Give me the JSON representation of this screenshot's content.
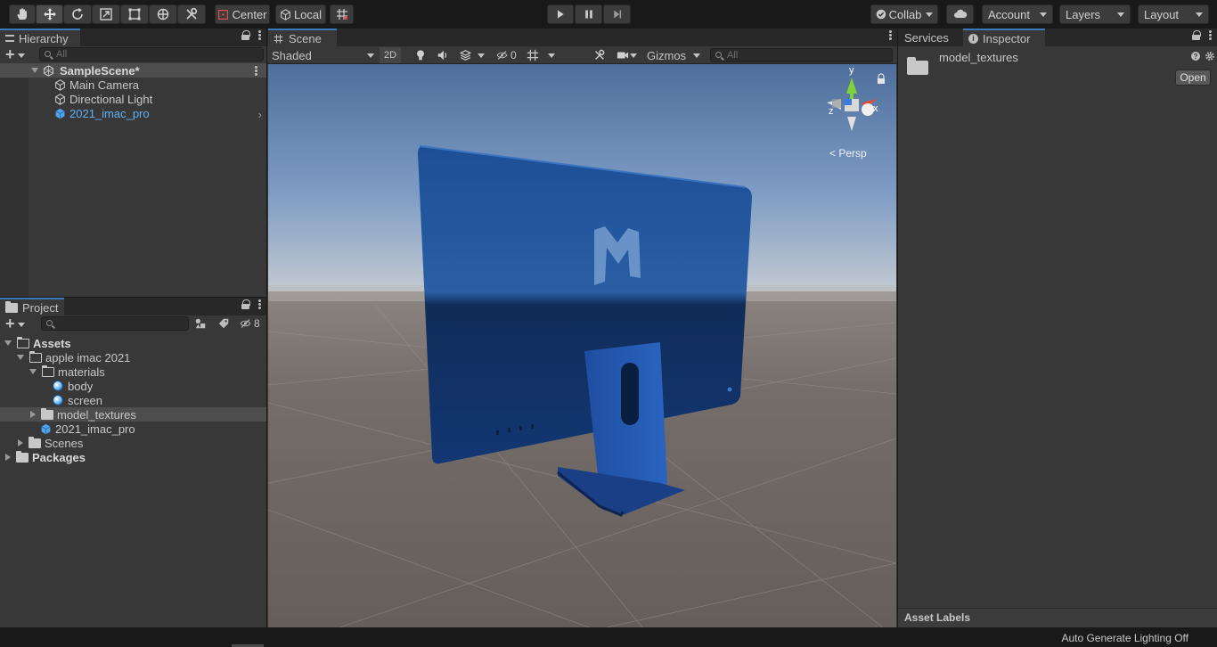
{
  "toolbar": {
    "pivot_mode": "Center",
    "pivot_rotation": "Local",
    "collab_label": "Collab",
    "account_label": "Account",
    "layers_label": "Layers",
    "layout_label": "Layout"
  },
  "hierarchy": {
    "tab_label": "Hierarchy",
    "search_placeholder": "All",
    "scene_name": "SampleScene*",
    "items": [
      {
        "label": "Main Camera",
        "icon": "gameobject-icon"
      },
      {
        "label": "Directional Light",
        "icon": "gameobject-icon"
      },
      {
        "label": "2021_imac_pro",
        "icon": "prefab-icon"
      }
    ]
  },
  "project": {
    "tab_label": "Project",
    "search_placeholder": "",
    "hidden_count": "8",
    "tree": [
      {
        "label": "Assets",
        "icon": "folder-open-icon"
      },
      {
        "label": "apple imac 2021",
        "icon": "folder-open-icon"
      },
      {
        "label": "materials",
        "icon": "folder-open-icon"
      },
      {
        "label": "body",
        "icon": "material-icon"
      },
      {
        "label": "screen",
        "icon": "material-icon"
      },
      {
        "label": "model_textures",
        "icon": "folder-icon"
      },
      {
        "label": "2021_imac_pro",
        "icon": "prefab-icon"
      },
      {
        "label": "Scenes",
        "icon": "folder-icon"
      },
      {
        "label": "Packages",
        "icon": "folder-icon"
      }
    ]
  },
  "scene": {
    "tab_label": "Scene",
    "shading_mode": "Shaded",
    "mode_2d": "2D",
    "hidden_objects": "0",
    "gizmos_label": "Gizmos",
    "search_placeholder": "All",
    "persp_label": "Persp",
    "gizmo_axes": {
      "y": "y",
      "x": "x",
      "z": "z"
    }
  },
  "inspector": {
    "services_tab": "Services",
    "inspector_tab": "Inspector",
    "asset_name": "model_textures",
    "open_button": "Open",
    "asset_labels": "Asset Labels"
  },
  "status": {
    "lighting": "Auto Generate Lighting Off"
  }
}
